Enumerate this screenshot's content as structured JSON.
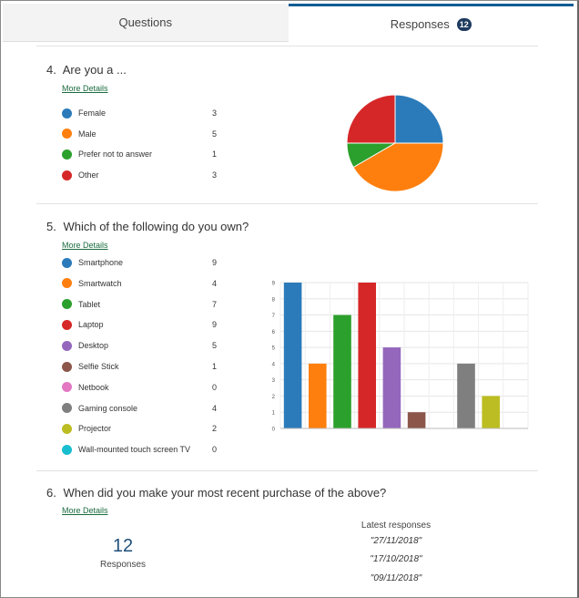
{
  "tabs": {
    "questions_label": "Questions",
    "responses_label": "Responses",
    "responses_count": "12"
  },
  "q4": {
    "number": "4.",
    "title": "Are you a ...",
    "more_details": "More Details",
    "items": [
      {
        "label": "Female",
        "count": "3",
        "color": "#2b7bba"
      },
      {
        "label": "Male",
        "count": "5",
        "color": "#ff7f0e"
      },
      {
        "label": "Prefer not to answer",
        "count": "1",
        "color": "#2ca02c"
      },
      {
        "label": "Other",
        "count": "3",
        "color": "#d62728"
      }
    ]
  },
  "q5": {
    "number": "5.",
    "title": "Which of the following do you own?",
    "more_details": "More Details",
    "items": [
      {
        "label": "Smartphone",
        "count": "9",
        "color": "#2b7bba"
      },
      {
        "label": "Smartwatch",
        "count": "4",
        "color": "#ff7f0e"
      },
      {
        "label": "Tablet",
        "count": "7",
        "color": "#2ca02c"
      },
      {
        "label": "Laptop",
        "count": "9",
        "color": "#d62728"
      },
      {
        "label": "Desktop",
        "count": "5",
        "color": "#9467bd"
      },
      {
        "label": "Selfie Stick",
        "count": "1",
        "color": "#8c564b"
      },
      {
        "label": "Netbook",
        "count": "0",
        "color": "#e377c2"
      },
      {
        "label": "Gaming console",
        "count": "4",
        "color": "#7f7f7f"
      },
      {
        "label": "Projector",
        "count": "2",
        "color": "#bcbd22"
      },
      {
        "label": "Wall-mounted touch screen TV",
        "count": "0",
        "color": "#17becf"
      }
    ]
  },
  "q6": {
    "number": "6.",
    "title": "When did you make your most recent purchase of the above?",
    "more_details": "More Details",
    "responses_count": "12",
    "responses_label": "Responses",
    "latest_title": "Latest responses",
    "latest": [
      "\"27/11/2018\"",
      "\"17/10/2018\"",
      "\"09/11/2018\""
    ]
  },
  "chart_data": [
    {
      "type": "pie",
      "categories": [
        "Female",
        "Male",
        "Prefer not to answer",
        "Other"
      ],
      "values": [
        3,
        5,
        1,
        3
      ],
      "colors": [
        "#2b7bba",
        "#ff7f0e",
        "#2ca02c",
        "#d62728"
      ]
    },
    {
      "type": "bar",
      "categories": [
        "Smartphone",
        "Smartwatch",
        "Tablet",
        "Laptop",
        "Desktop",
        "Selfie Stick",
        "Netbook",
        "Gaming console",
        "Projector",
        "Wall-mounted touch screen TV"
      ],
      "values": [
        9,
        4,
        7,
        9,
        5,
        1,
        0,
        4,
        2,
        0
      ],
      "colors": [
        "#2b7bba",
        "#ff7f0e",
        "#2ca02c",
        "#d62728",
        "#9467bd",
        "#8c564b",
        "#e377c2",
        "#7f7f7f",
        "#bcbd22",
        "#17becf"
      ],
      "ylim": [
        0,
        9
      ],
      "yticks": [
        "0",
        "1",
        "2",
        "3",
        "4",
        "5",
        "6",
        "7",
        "8",
        "9"
      ],
      "grid": true
    }
  ]
}
